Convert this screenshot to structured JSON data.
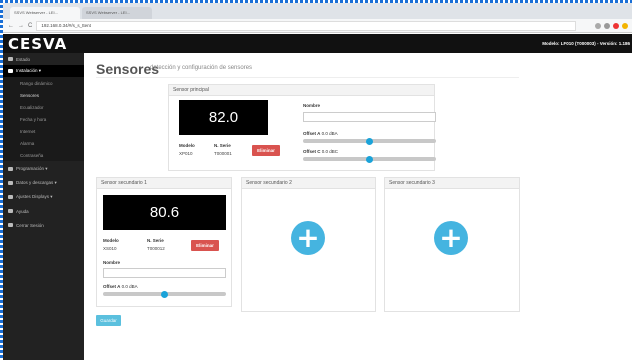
{
  "browser": {
    "tabs": [
      "SSVS Webserver - LEI...",
      "SSVS Webserver - LEI..."
    ],
    "url": "192.168.0.34/#/s_s_ttent"
  },
  "header": {
    "logo": "CESVA",
    "model_version": "Modelo: LF010 (T000003) - Versión: 1.186"
  },
  "sidebar": {
    "items": [
      {
        "label": "Estado",
        "icon": "home-icon"
      },
      {
        "label": "Instalación ▾",
        "icon": "wrench-icon"
      },
      {
        "label": "Rango dinámico"
      },
      {
        "label": "Sensores"
      },
      {
        "label": "Ecualizador"
      },
      {
        "label": "Fecha y hora"
      },
      {
        "label": "Internet"
      },
      {
        "label": "Alarma"
      },
      {
        "label": "Contraseña"
      },
      {
        "label": "Programación ▾",
        "icon": "calendar-icon"
      },
      {
        "label": "Datos y descargas ▾",
        "icon": "bar-chart-icon"
      },
      {
        "label": "Ajustes Displays ▾",
        "icon": "display-icon"
      },
      {
        "label": "Ayuda",
        "icon": "help-icon"
      },
      {
        "label": "Cerrar Sesión",
        "icon": "logout-icon"
      }
    ]
  },
  "main": {
    "title": "Sensores",
    "subtitle": "detección y configuración de sensores",
    "main_sensor": {
      "header": "Sensor principal",
      "reading": "82.0",
      "model_label": "Modelo",
      "model": "XP010",
      "serial_label": "N. Serie",
      "serial": "T000001",
      "delete": "Eliminar",
      "name_label": "Nombre",
      "name_value": "",
      "offset_a_label": "Offset A",
      "offset_a_value": "0.0 dBA",
      "offset_a_pos": 0.5,
      "offset_c_label": "Offset C",
      "offset_c_value": "0.0 dBC",
      "offset_c_pos": 0.5
    },
    "secondary": [
      {
        "header": "Sensor secundario 1",
        "reading": "80.6",
        "model_label": "Modelo",
        "model": "XS010",
        "serial_label": "N. Serie",
        "serial": "T000012",
        "delete": "Eliminar",
        "name_label": "Nombre",
        "name_value": "",
        "offset_a_label": "Offset A",
        "offset_a_value": "0.0 dBA",
        "offset_a_pos": 0.5
      },
      {
        "header": "Sensor secundario 2"
      },
      {
        "header": "Sensor secundario 3"
      }
    ],
    "save": "Guardar"
  }
}
